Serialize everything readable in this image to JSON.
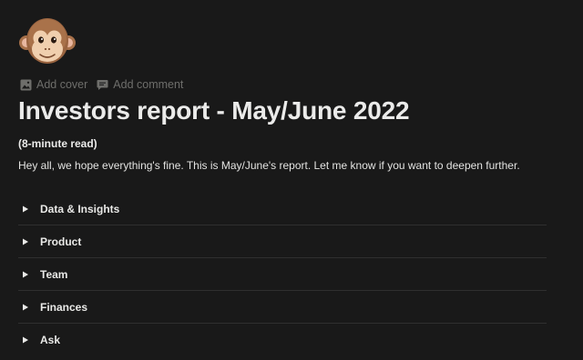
{
  "page": {
    "icon": "monkey-face-icon",
    "controls": {
      "add_cover": "Add cover",
      "add_comment": "Add comment"
    },
    "title": "Investors report - May/June 2022",
    "read_time": "(8-minute read)",
    "intro": "Hey all, we hope everything's fine. This is May/June's report. Let me know if you want to deepen further."
  },
  "toggles": [
    {
      "label": "Data & Insights"
    },
    {
      "label": "Product"
    },
    {
      "label": "Team"
    },
    {
      "label": "Finances"
    },
    {
      "label": "Ask"
    }
  ],
  "colors": {
    "background": "#191919",
    "text": "#e9e9e7",
    "muted": "#6e6e6b",
    "divider": "#2f2f2f"
  }
}
